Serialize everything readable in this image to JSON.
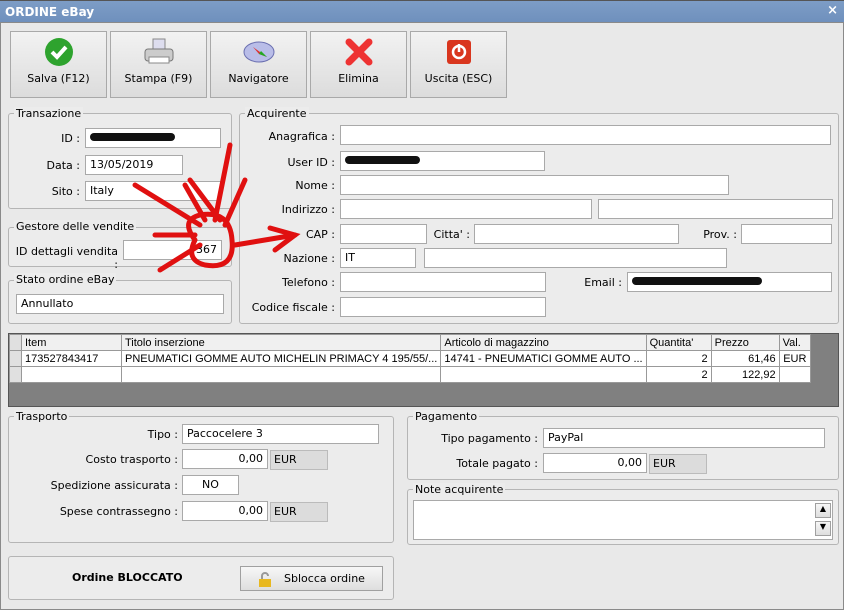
{
  "window": {
    "title": "ORDINE eBay",
    "close": "×"
  },
  "toolbar": [
    {
      "label": "Salva (F12)",
      "icon": "check-icon"
    },
    {
      "label": "Stampa (F9)",
      "icon": "printer-icon"
    },
    {
      "label": "Navigatore",
      "icon": "compass-icon"
    },
    {
      "label": "Elimina",
      "icon": "x-icon"
    },
    {
      "label": "Uscita (ESC)",
      "icon": "power-icon"
    }
  ],
  "transazione": {
    "title": "Transazione",
    "id_label": "ID :",
    "id": "",
    "data_label": "Data :",
    "data": "13/05/2019",
    "sito_label": "Sito :",
    "sito": "Italy"
  },
  "gestore": {
    "title": "Gestore delle vendite",
    "id_label": "ID dettagli vendita :",
    "id": "367"
  },
  "stato": {
    "title": "Stato ordine eBay",
    "value": "Annullato"
  },
  "acquirente": {
    "title": "Acquirente",
    "anagrafica_label": "Anagrafica :",
    "anagrafica": "",
    "userid_label": "User ID :",
    "userid": "",
    "nome_label": "Nome :",
    "nome": "",
    "indirizzo_label": "Indirizzo :",
    "indirizzo": "",
    "indirizzo2": "",
    "cap_label": "CAP :",
    "cap": "",
    "citta_label": "Citta' :",
    "citta": "",
    "prov_label": "Prov. :",
    "prov": "",
    "nazione_label": "Nazione :",
    "nazione": "IT",
    "nazione2": "",
    "telefono_label": "Telefono :",
    "telefono": "",
    "email_label": "Email :",
    "email": "",
    "cf_label": "Codice fiscale :",
    "cf": ""
  },
  "table": {
    "headers": [
      "Item",
      "Titolo inserzione",
      "Articolo di magazzino",
      "Quantita'",
      "Prezzo",
      "Val."
    ],
    "rows": [
      [
        "173527843417",
        "PNEUMATICI GOMME AUTO MICHELIN PRIMACY 4 195/55/...",
        "14741 - PNEUMATICI GOMME AUTO ...",
        "2",
        "61,46",
        "EUR"
      ]
    ],
    "totals": {
      "qty": "2",
      "price": "122,92"
    }
  },
  "trasporto": {
    "title": "Trasporto",
    "tipo_label": "Tipo :",
    "tipo": "Paccocelere 3",
    "costo_label": "Costo trasporto :",
    "costo": "0,00",
    "costo_cur": "EUR",
    "sped_label": "Spedizione assicurata :",
    "sped": "NO",
    "contr_label": "Spese contrassegno :",
    "contr": "0,00",
    "contr_cur": "EUR"
  },
  "pagamento": {
    "title": "Pagamento",
    "tipo_label": "Tipo pagamento :",
    "tipo": "PayPal",
    "totale_label": "Totale pagato :",
    "totale": "0,00",
    "cur": "EUR"
  },
  "note": {
    "title": "Note acquirente",
    "value": ""
  },
  "blocco": {
    "label": "Ordine BLOCCATO",
    "button": "Sblocca ordine"
  }
}
